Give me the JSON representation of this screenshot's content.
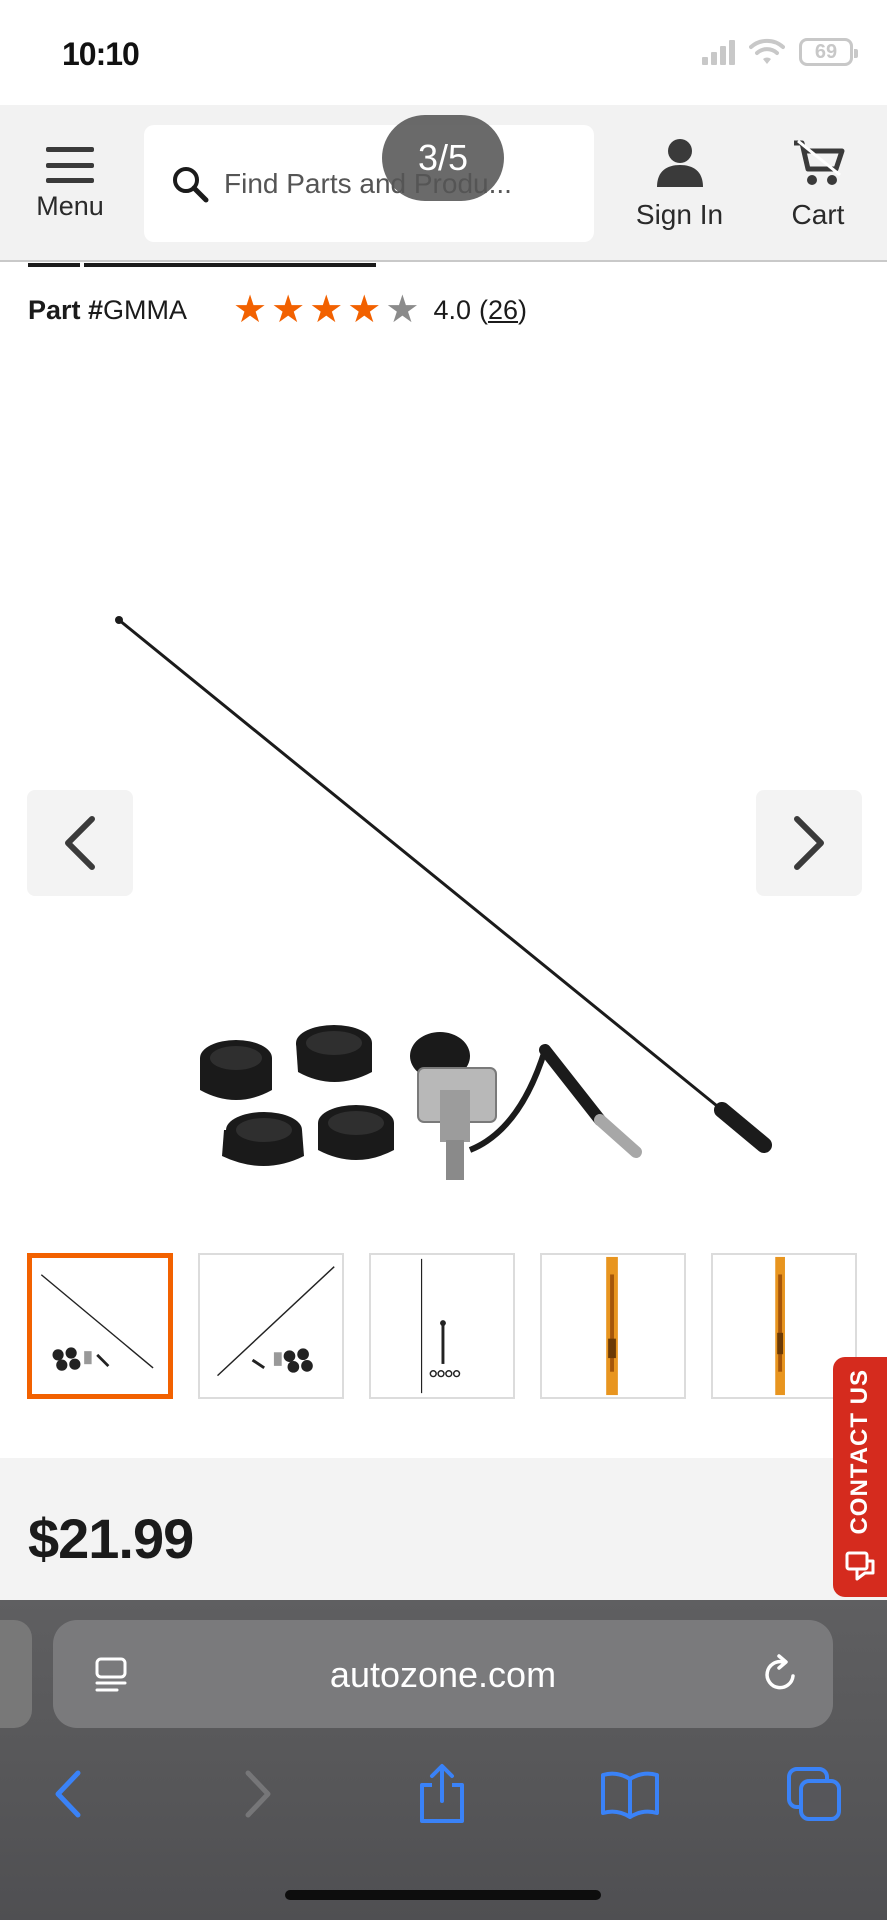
{
  "status_bar": {
    "time": "10:10",
    "battery": "69"
  },
  "header": {
    "menu_label": "Menu",
    "search_placeholder": "Find Parts and Produ...",
    "gallery_counter": "3/5",
    "signin_label": "Sign In",
    "cart_label": "Cart"
  },
  "product": {
    "part_label": "Part #",
    "part_number": "GMMA",
    "rating_value": "4.0",
    "rating_stars_filled": 4,
    "rating_stars_total": 5,
    "review_count": "26",
    "price": "$21.99",
    "thumbnail_count": 5,
    "active_thumbnail": 1
  },
  "contact_tab": {
    "label": "CONTACT US"
  },
  "browser": {
    "url": "autozone.com"
  },
  "colors": {
    "accent": "#f26100",
    "contact": "#d52b1e",
    "ios_blue": "#3a82f7"
  }
}
